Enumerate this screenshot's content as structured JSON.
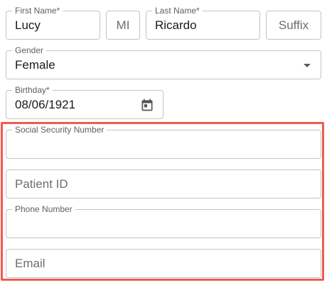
{
  "name": {
    "first_label": "First Name*",
    "first_value": "Lucy",
    "middle_placeholder": "MI",
    "last_label": "Last Name*",
    "last_value": "Ricardo",
    "suffix_placeholder": "Suffix"
  },
  "gender": {
    "label": "Gender",
    "value": "Female",
    "icon": "caret-down-icon"
  },
  "birthday": {
    "label": "Birthday*",
    "value": "08/06/1921",
    "icon": "calendar-icon"
  },
  "contact": {
    "ssn_label": "Social Security Number",
    "ssn_value": "",
    "patient_id_placeholder": "Patient ID",
    "phone_label": "Phone Number",
    "phone_value": "",
    "email_placeholder": "Email"
  },
  "colors": {
    "highlight": "#f25a4f",
    "border": "#c4c4c4",
    "label": "#5f5f5f"
  }
}
